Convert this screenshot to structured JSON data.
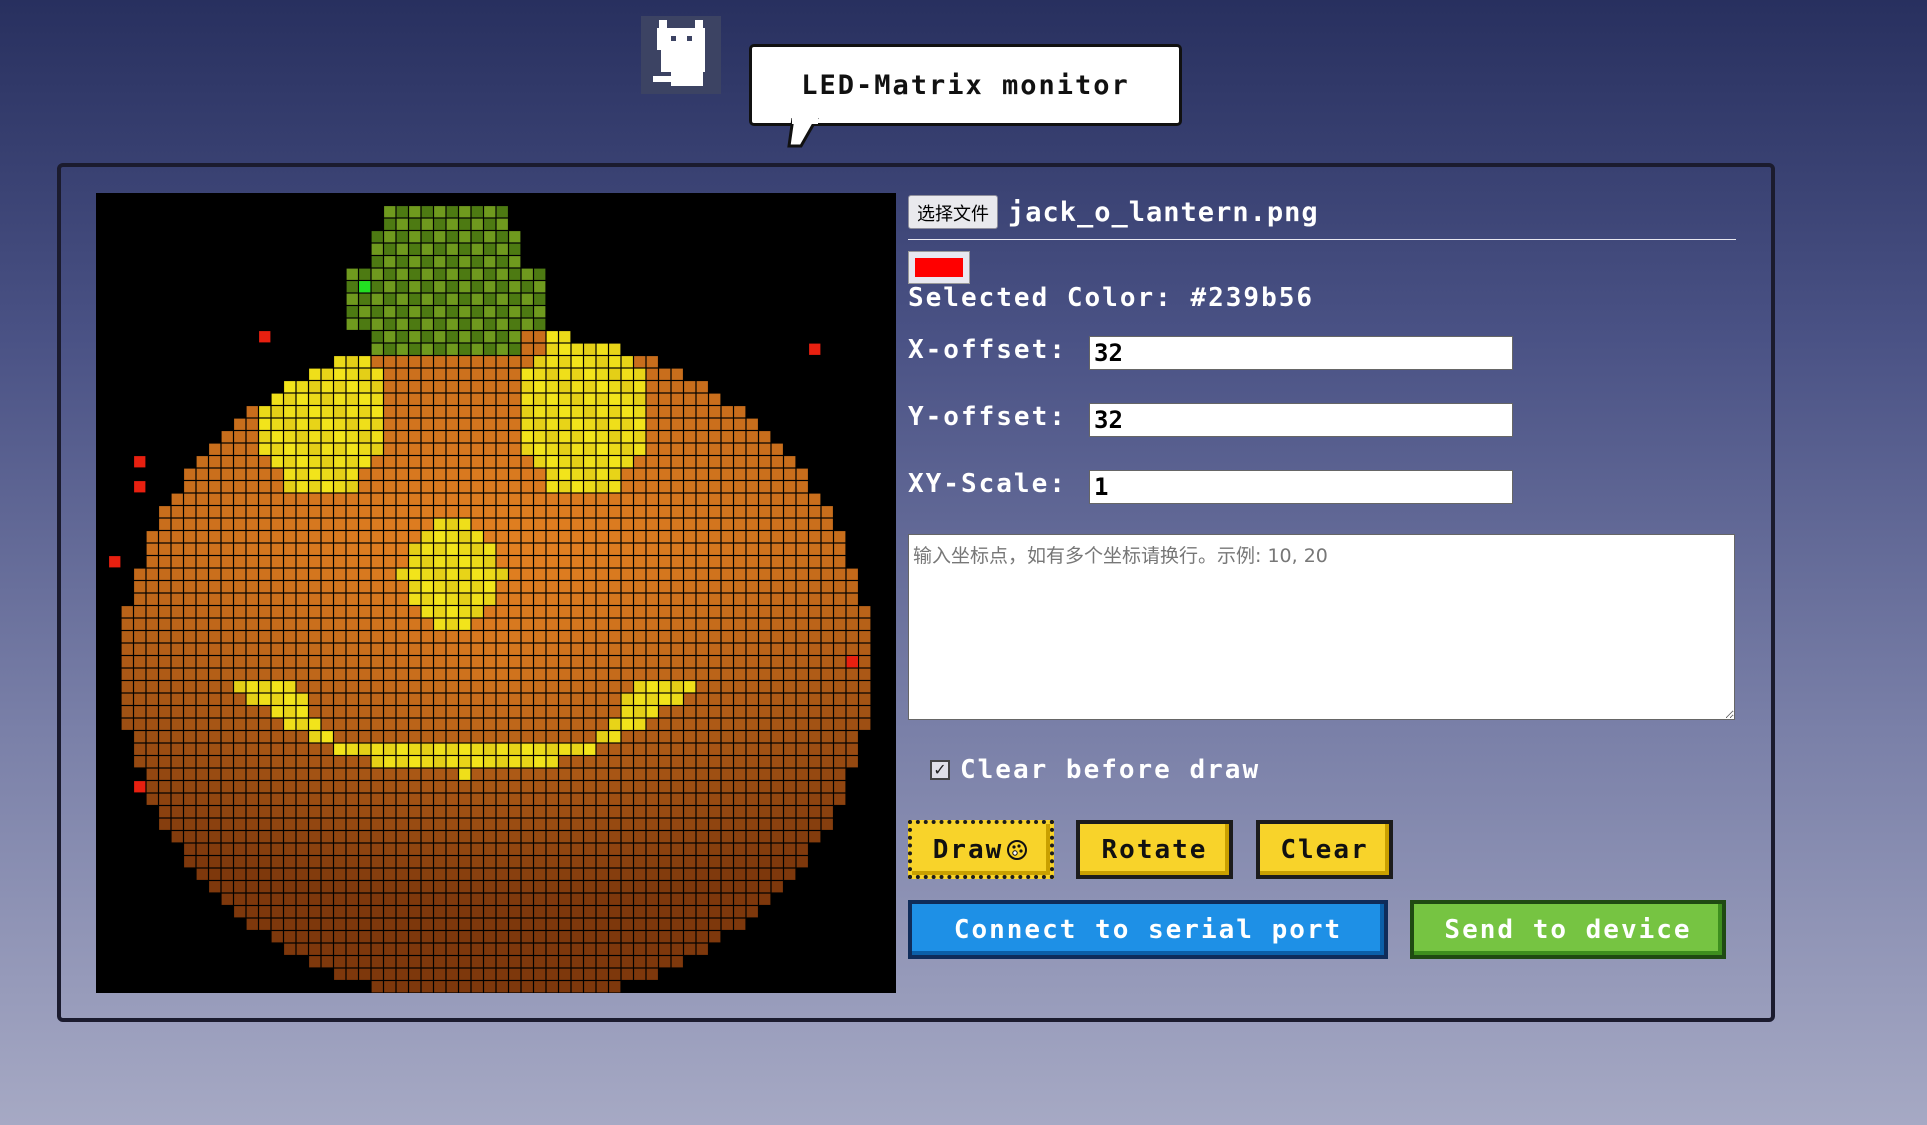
{
  "header": {
    "logo_icon": "pixel-cat-icon",
    "title": "LED-Matrix monitor"
  },
  "file": {
    "button_label": "选择文件",
    "file_name": "jack_o_lantern.png"
  },
  "color": {
    "swatch_value": "#ff0000",
    "selected_label": "Selected Color: #239b56"
  },
  "fields": {
    "x_offset_label": "X-offset:",
    "x_offset_value": "32",
    "y_offset_label": "Y-offset:",
    "y_offset_value": "32",
    "scale_label": "XY-Scale:",
    "scale_value": "1"
  },
  "coords": {
    "placeholder": "输入坐标点，如有多个坐标请换行。示例: 10, 20"
  },
  "options": {
    "clear_before_draw_label": "Clear before draw",
    "clear_before_draw_checked": true
  },
  "buttons": {
    "draw": "Draw",
    "draw_icon": "palette-icon",
    "rotate": "Rotate",
    "clear": "Clear",
    "connect": "Connect to serial port",
    "send": "Send to device"
  },
  "matrix": {
    "columns": 64,
    "rows": 64,
    "image": "jack-o-lantern pixel art",
    "colors": {
      "background": "#000000",
      "stem_light": "#6f9a1e",
      "stem_dark": "#4d7a12",
      "orange_light": "#f08a24",
      "orange_dark": "#6a2a08",
      "glow": "#f2e41b",
      "red_pixel": "#e82010",
      "green_pixel": "#22e022"
    }
  }
}
